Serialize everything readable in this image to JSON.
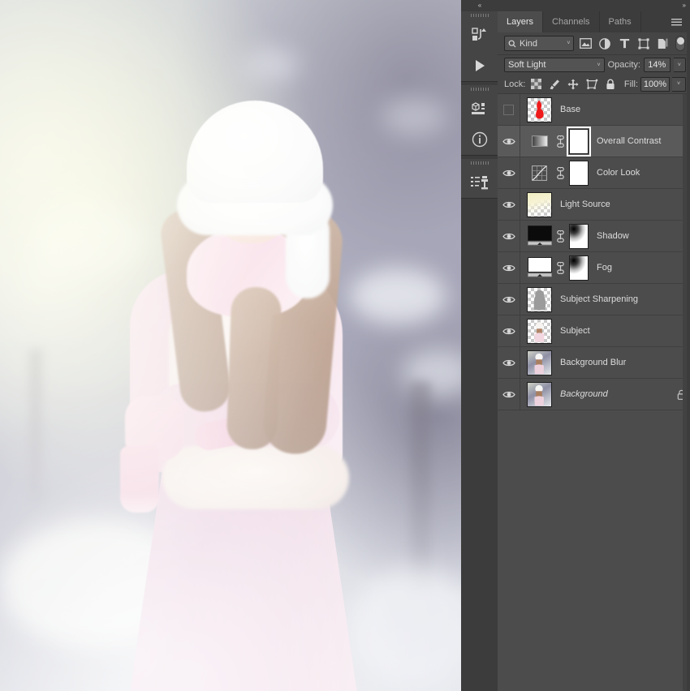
{
  "app": {
    "collapse_left": "«",
    "collapse_right": "»"
  },
  "icon_dock": {
    "groups": [
      {
        "name": "history-actions-group",
        "buttons": [
          {
            "icon": "history-icon",
            "label": "History"
          },
          {
            "icon": "play-actions-icon",
            "label": "Actions"
          }
        ]
      },
      {
        "name": "properties-info-group",
        "buttons": [
          {
            "icon": "properties-icon",
            "label": "Properties"
          },
          {
            "icon": "info-icon",
            "label": "Info"
          }
        ]
      },
      {
        "name": "clone-source-group",
        "buttons": [
          {
            "icon": "clone-source-icon",
            "label": "Clone Source"
          }
        ]
      }
    ]
  },
  "panel": {
    "tabs": [
      {
        "label": "Layers",
        "active": true
      },
      {
        "label": "Channels",
        "active": false
      },
      {
        "label": "Paths",
        "active": false
      }
    ],
    "menu_icon": "hamburger-menu-icon",
    "filter": {
      "kind_icon": "search-icon",
      "kind_label": "Kind",
      "caret": "˅",
      "icons": [
        {
          "name": "filter-pixel-icon",
          "title": "Pixel layers"
        },
        {
          "name": "filter-adjustment-icon",
          "title": "Adjustment layers"
        },
        {
          "name": "filter-type-icon",
          "title": "Type layers"
        },
        {
          "name": "filter-shape-icon",
          "title": "Shape layers"
        },
        {
          "name": "filter-smartobject-icon",
          "title": "Smart objects"
        }
      ],
      "toggle": "filter-enable-toggle"
    },
    "blend": {
      "mode": "Soft Light",
      "opacity_label": "Opacity:",
      "opacity_value": "14%",
      "fill_label": "Fill:",
      "fill_value": "100%"
    },
    "lock": {
      "label": "Lock:",
      "icons": [
        {
          "name": "lock-transparent-pixels-icon"
        },
        {
          "name": "lock-image-pixels-icon"
        },
        {
          "name": "lock-position-icon"
        },
        {
          "name": "lock-artboard-nesting-icon"
        },
        {
          "name": "lock-all-icon"
        }
      ]
    },
    "layers": [
      {
        "name": "Base",
        "visible": false,
        "selected": false,
        "thumb": "shape-red",
        "kind": "pixel",
        "has_mask": false,
        "linked": false,
        "locked": false,
        "italic": false
      },
      {
        "name": "Overall Contrast",
        "visible": true,
        "selected": true,
        "thumb": "gradient-map-bw",
        "kind": "adjustment",
        "has_mask": true,
        "mask": "white",
        "mask_active": true,
        "linked": true,
        "locked": false,
        "italic": false
      },
      {
        "name": "Color Look",
        "visible": true,
        "selected": false,
        "thumb": "curves",
        "kind": "adjustment",
        "has_mask": true,
        "mask": "white",
        "mask_active": false,
        "linked": true,
        "locked": false,
        "italic": false
      },
      {
        "name": "Light Source",
        "visible": true,
        "selected": false,
        "thumb": "warm-gradient",
        "kind": "pixel",
        "has_mask": false,
        "linked": false,
        "locked": false,
        "italic": false
      },
      {
        "name": "Shadow",
        "visible": true,
        "selected": false,
        "thumb": "levels-black",
        "kind": "adjustment",
        "has_mask": true,
        "mask": "gradient",
        "mask_active": false,
        "linked": true,
        "locked": false,
        "italic": false
      },
      {
        "name": "Fog",
        "visible": true,
        "selected": false,
        "thumb": "levels-white",
        "kind": "adjustment",
        "has_mask": true,
        "mask": "gradient",
        "mask_active": false,
        "linked": true,
        "locked": false,
        "italic": false
      },
      {
        "name": "Subject Sharpening",
        "visible": true,
        "selected": false,
        "thumb": "subject-gray",
        "kind": "pixel",
        "has_mask": false,
        "linked": false,
        "locked": false,
        "italic": false
      },
      {
        "name": "Subject",
        "visible": true,
        "selected": false,
        "thumb": "subject-color",
        "kind": "pixel",
        "has_mask": false,
        "linked": false,
        "locked": false,
        "italic": false
      },
      {
        "name": "Background Blur",
        "visible": true,
        "selected": false,
        "thumb": "photo",
        "kind": "pixel",
        "has_mask": false,
        "linked": false,
        "locked": false,
        "italic": false
      },
      {
        "name": "Background",
        "visible": true,
        "selected": false,
        "thumb": "photo",
        "kind": "pixel",
        "has_mask": false,
        "linked": false,
        "locked": true,
        "italic": true
      }
    ]
  },
  "canvas": {
    "description": "Soft pastel winter portrait of a young girl in a white fur hat, pink scarf and pink coat against a blurred snowy forest",
    "colors": {
      "haze_left": "#e2e5be",
      "forest_right": "#5c5c76",
      "coat_pink": "#ecc9da",
      "fur_white": "#fbf4ef",
      "hair_brown": "#a8846a"
    }
  }
}
